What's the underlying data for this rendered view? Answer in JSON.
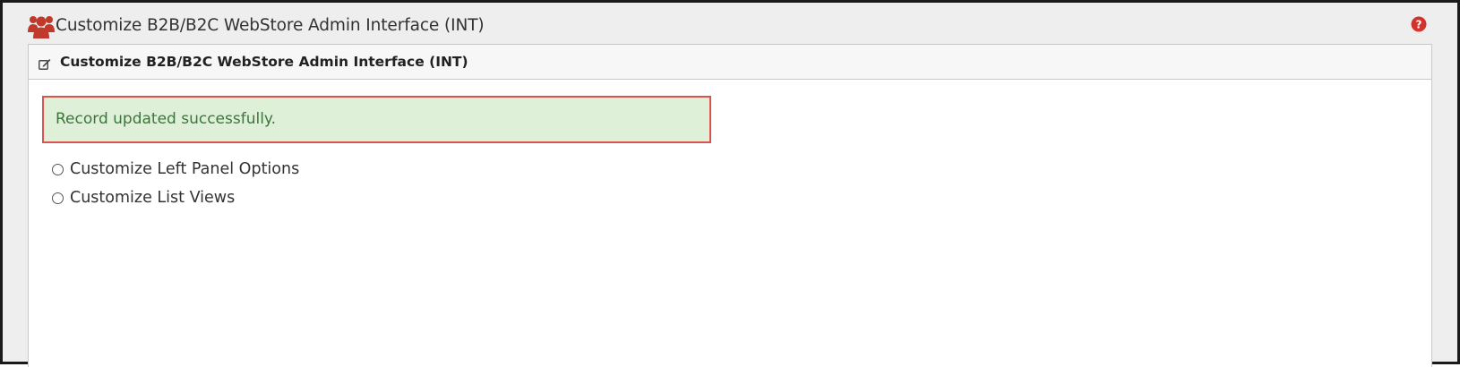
{
  "page": {
    "title": "Customize B2B/B2C WebStore Admin Interface (INT)",
    "header_icon": "users-icon",
    "help_icon": "question-circle-icon"
  },
  "panel": {
    "title": "Customize B2B/B2C WebStore Admin Interface (INT)",
    "heading_icon": "edit-icon"
  },
  "alert": {
    "message": "Record updated successfully."
  },
  "options": [
    {
      "label": "Customize Left Panel Options",
      "selected": false
    },
    {
      "label": "Customize List Views",
      "selected": false
    }
  ],
  "colors": {
    "accent_red": "#c0392b",
    "success_bg": "#dff0d8",
    "success_text": "#3c763d",
    "alert_border": "#d9534f"
  }
}
